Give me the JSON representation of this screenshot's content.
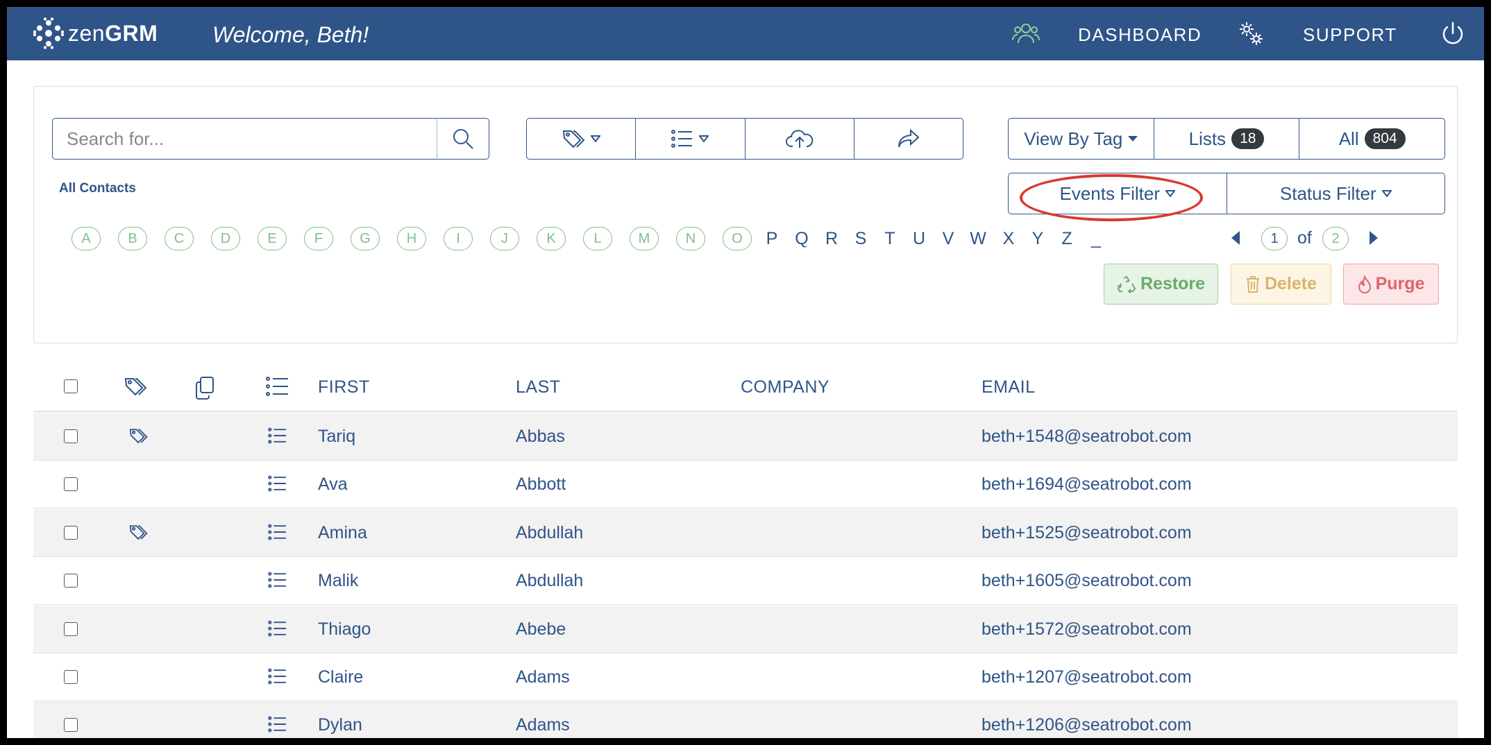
{
  "navbar": {
    "logo_thin": "zen",
    "logo_bold": "GRM",
    "welcome": "Welcome, Beth!",
    "dashboard": "DASHBOARD",
    "support": "SUPPORT",
    "icons": [
      "users-icon",
      "gears-icon",
      "power-icon"
    ]
  },
  "search": {
    "placeholder": "Search for..."
  },
  "toolbar": {
    "icons": [
      "tag-icon",
      "list-icon",
      "cloud-upload-icon",
      "share-icon"
    ]
  },
  "view": {
    "view_by_tag": "View By Tag",
    "lists_label": "Lists",
    "lists_count": "18",
    "all_label": "All",
    "all_count": "804",
    "events_filter": "Events Filter",
    "status_filter": "Status Filter"
  },
  "all_contacts": "All Contacts",
  "alphabet_pills": [
    "A",
    "B",
    "C",
    "D",
    "E",
    "F",
    "G",
    "H",
    "I",
    "J",
    "K",
    "L",
    "M",
    "N",
    "O"
  ],
  "alphabet_plain": [
    "P",
    "Q",
    "R",
    "S",
    "T",
    "U",
    "V",
    "W",
    "X",
    "Y",
    "Z",
    "_"
  ],
  "pager": {
    "current": "1",
    "of": "of",
    "total": "2"
  },
  "actions": {
    "restore": "Restore",
    "delete": "Delete",
    "purge": "Purge"
  },
  "table": {
    "headers": {
      "first": "FIRST",
      "last": "LAST",
      "company": "COMPANY",
      "email": "EMAIL"
    },
    "rows": [
      {
        "first": "Tariq",
        "last": "Abbas",
        "company": "",
        "email": "beth+1548@seatrobot.com",
        "tag": true
      },
      {
        "first": "Ava",
        "last": "Abbott",
        "company": "",
        "email": "beth+1694@seatrobot.com",
        "tag": false
      },
      {
        "first": "Amina",
        "last": "Abdullah",
        "company": "",
        "email": "beth+1525@seatrobot.com",
        "tag": true
      },
      {
        "first": "Malik",
        "last": "Abdullah",
        "company": "",
        "email": "beth+1605@seatrobot.com",
        "tag": false
      },
      {
        "first": "Thiago",
        "last": "Abebe",
        "company": "",
        "email": "beth+1572@seatrobot.com",
        "tag": false
      },
      {
        "first": "Claire",
        "last": "Adams",
        "company": "",
        "email": "beth+1207@seatrobot.com",
        "tag": false
      },
      {
        "first": "Dylan",
        "last": "Adams",
        "company": "",
        "email": "beth+1206@seatrobot.com",
        "tag": false
      }
    ]
  },
  "colors": {
    "navbar": "#2f5488",
    "primary": "#2f5488",
    "pill": "#7fc08a",
    "restore": "#6aaa6a",
    "delete": "#d9b370",
    "purge": "#e0646a",
    "highlight": "#d8382f"
  }
}
